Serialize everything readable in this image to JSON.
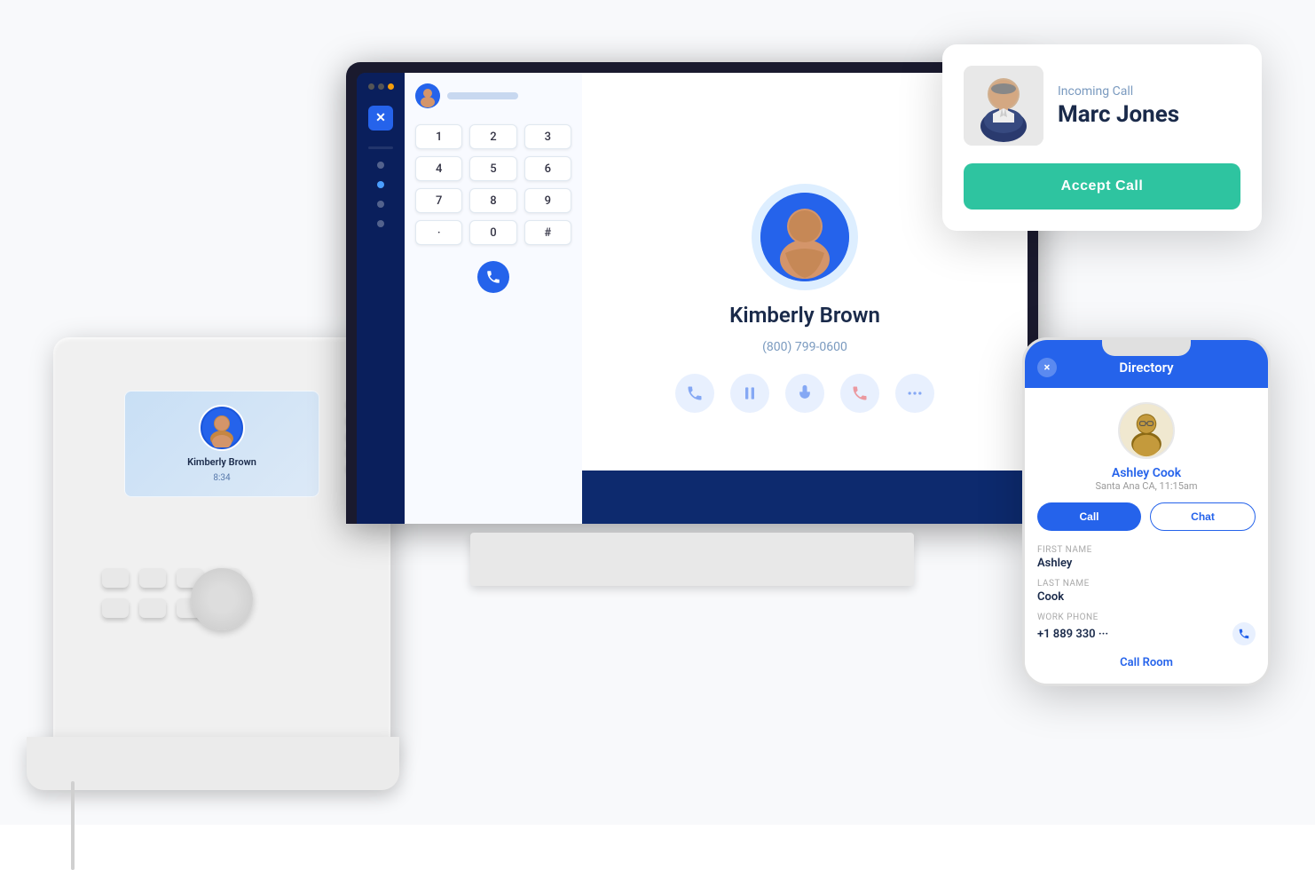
{
  "scene": {
    "bg": "#f8f9fb"
  },
  "desk_phone": {
    "screen": {
      "contact_name": "Kimberly Brown",
      "call_time": "8:34"
    }
  },
  "laptop": {
    "dialer": {
      "keys": [
        "1",
        "2",
        "3",
        "4",
        "5",
        "6",
        "7",
        "8",
        "9",
        ".",
        "0",
        "#"
      ]
    },
    "call": {
      "contact_name": "Kimberly Brown",
      "contact_number": "(800) 799-0600"
    }
  },
  "incoming_call_popup": {
    "label": "Incoming Call",
    "caller_name": "Marc Jones",
    "accept_button": "Accept Call"
  },
  "mobile_directory": {
    "title": "Directory",
    "close_label": "×",
    "contact": {
      "name": "Ashley Cook",
      "location": "Santa Ana CA, 11:15am",
      "first_name_label": "First name",
      "first_name": "Ashley",
      "last_name_label": "Last name",
      "last_name": "Cook",
      "work_phone_label": "Work Phone",
      "work_phone": "+1 889 330 ···",
      "call_button": "Call",
      "chat_button": "Chat",
      "call_room_label": "Call Room"
    }
  }
}
